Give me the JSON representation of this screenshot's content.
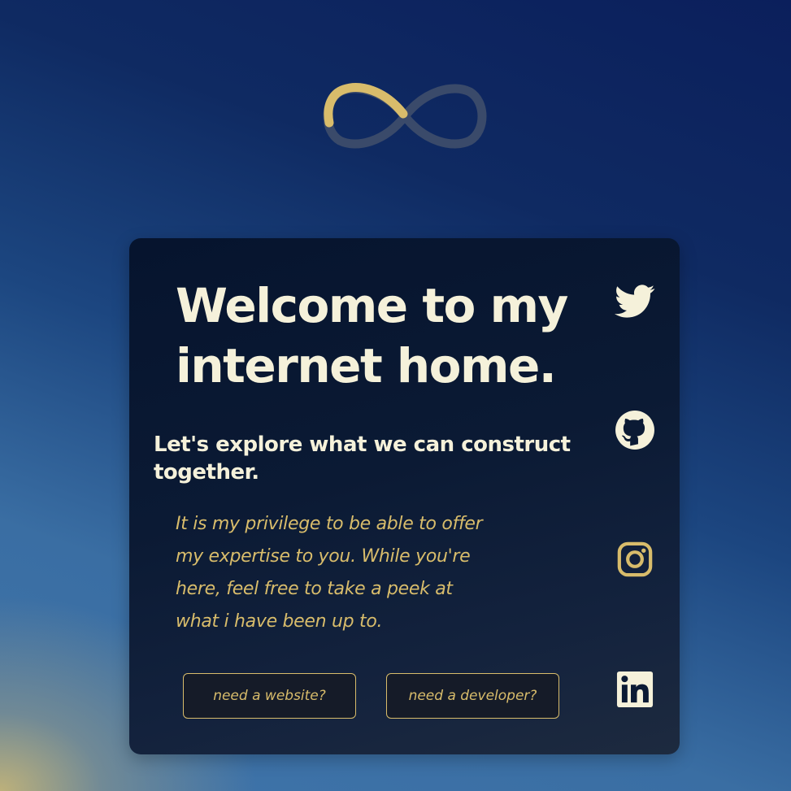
{
  "hero": {
    "title_line1": "Welcome to my",
    "title_line2": "internet home.",
    "subtitle": "Let's explore what we can construct together.",
    "text_lines": [
      "It is my privilege to be able to offer",
      "my expertise to you. While you're",
      "here, feel free to take a peek at",
      "what i have been up to."
    ]
  },
  "buttons": {
    "website_label": "need a website?",
    "developer_label": "need a developer?"
  },
  "social": [
    {
      "icon": "twitter-icon"
    },
    {
      "icon": "github-icon"
    },
    {
      "icon": "instagram-icon"
    },
    {
      "icon": "linkedin-icon"
    }
  ],
  "logo": {
    "icon": "infinity-icon",
    "loading_progress": 0.25
  },
  "colors": {
    "text_light": "#f5f1da",
    "accent_gold": "#d8bc6b",
    "card_bg": "#0b1a34",
    "infinity_track": "#3a4a6a"
  }
}
